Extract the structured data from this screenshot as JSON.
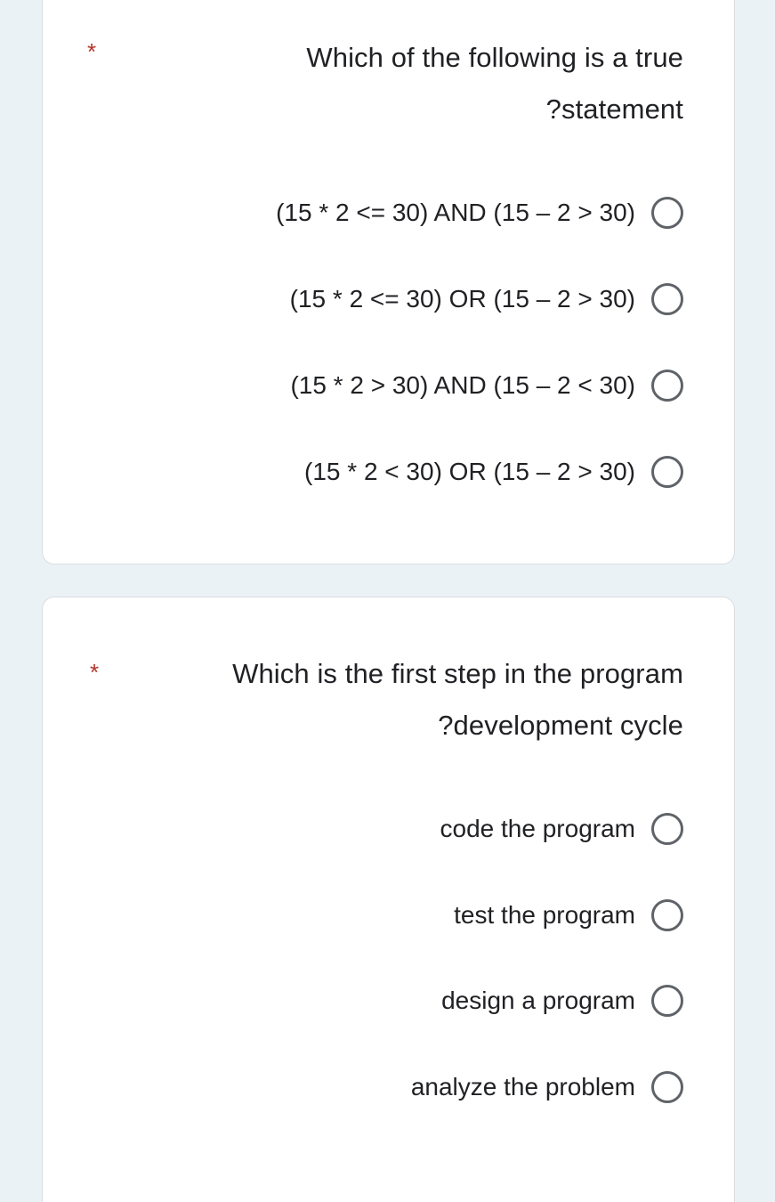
{
  "form": {
    "required_marker": "*",
    "questions": [
      {
        "id": "q1",
        "title": "Which of the following is a true\n?statement",
        "required": true,
        "selected": null,
        "options": [
          {
            "label": "(15 * 2 <= 30) AND (15 – 2 > 30)"
          },
          {
            "label": "(15 * 2 <= 30) OR (15 – 2 > 30)"
          },
          {
            "label": "(15 * 2 > 30) AND (15 – 2 < 30)"
          },
          {
            "label": "(15 * 2 < 30) OR (15 – 2 > 30)"
          }
        ]
      },
      {
        "id": "q2",
        "title": "Which is the first step in the program\n?development cycle",
        "required": true,
        "selected": null,
        "options": [
          {
            "label": "code the program"
          },
          {
            "label": "test the program"
          },
          {
            "label": "design a program"
          },
          {
            "label": "analyze the problem"
          }
        ]
      }
    ]
  },
  "theme": {
    "page_background": "#eaf2f6",
    "card_background": "#ffffff",
    "card_border": "#dadce0",
    "text_color": "#202124",
    "required_color": "#b3332a",
    "radio_border": "#5f6368"
  }
}
